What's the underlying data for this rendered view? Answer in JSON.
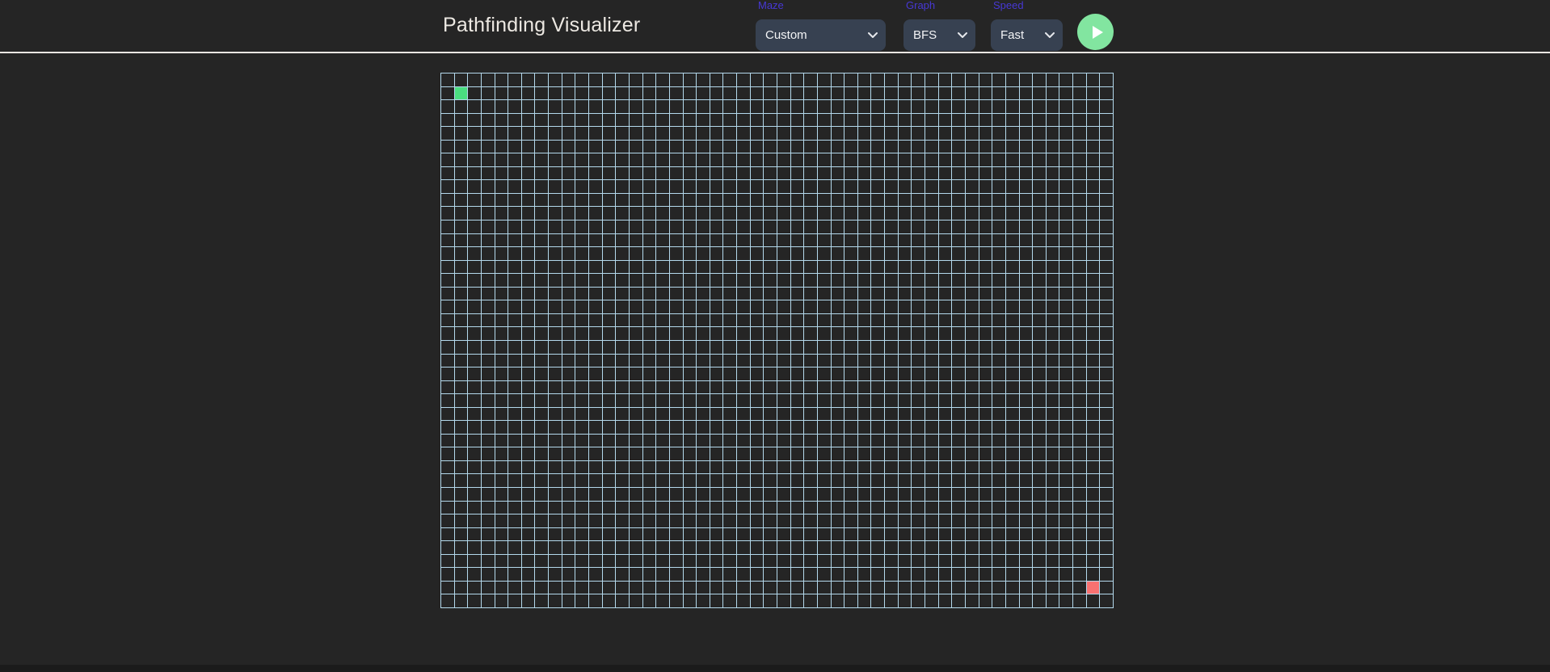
{
  "header": {
    "title": "Pathfinding Visualizer",
    "controls": [
      {
        "id": "maze",
        "label": "Maze",
        "value": "Custom"
      },
      {
        "id": "graph",
        "label": "Graph",
        "value": "BFS"
      },
      {
        "id": "speed",
        "label": "Speed",
        "value": "Fast"
      }
    ],
    "play_button": {
      "icon": "play-icon"
    }
  },
  "grid": {
    "rows": 40,
    "cols": 50,
    "start": {
      "row": 1,
      "col": 1
    },
    "end": {
      "row": 38,
      "col": 48
    }
  },
  "colors": {
    "background": "#252525",
    "header_border": "#e9e6e2",
    "title_text": "#ece8e2",
    "label": "#4738d4",
    "select_bg": "#374151",
    "select_text": "#f3f4f6",
    "grid_line": "#b4d9ec",
    "start_node": "#4ade80",
    "end_node": "#f87171",
    "play_button": "#82e5a0"
  }
}
